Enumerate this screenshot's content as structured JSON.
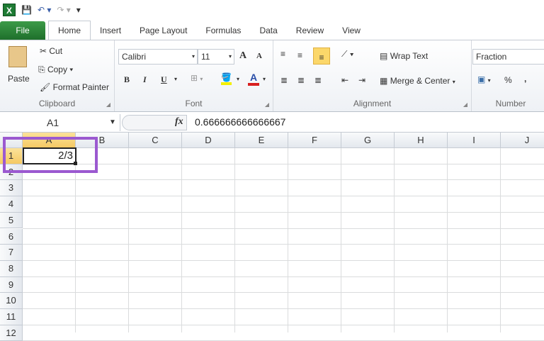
{
  "qat": {
    "app_icon": "X",
    "save_icon": "save-icon",
    "undo_icon": "undo-icon",
    "redo_icon": "redo-icon",
    "customize": "▾"
  },
  "tabs": [
    "File",
    "Home",
    "Insert",
    "Page Layout",
    "Formulas",
    "Data",
    "Review",
    "View"
  ],
  "clipboard": {
    "paste": "Paste",
    "cut": "Cut",
    "copy": "Copy",
    "format_painter": "Format Painter",
    "label": "Clipboard"
  },
  "font": {
    "name": "Calibri",
    "size": "11",
    "label": "Font",
    "bold": "B",
    "italic": "I",
    "underline": "U",
    "grow": "A",
    "shrink": "A",
    "color": "A"
  },
  "alignment": {
    "wrap": "Wrap Text",
    "merge": "Merge & Center",
    "label": "Alignment"
  },
  "number": {
    "format": "Fraction",
    "percent": "%",
    "comma": ",",
    "label": "Number"
  },
  "formula_bar": {
    "name_box": "A1",
    "fx": "fx",
    "value": "0.666666666666667"
  },
  "columns": [
    "A",
    "B",
    "C",
    "D",
    "E",
    "F",
    "G",
    "H",
    "I",
    "J"
  ],
  "rows": [
    "1",
    "2",
    "3",
    "4",
    "5",
    "6",
    "7",
    "8",
    "9",
    "10",
    "11",
    "12"
  ],
  "cells": {
    "A1": "2/3"
  },
  "highlight_color": "#9b59d0"
}
